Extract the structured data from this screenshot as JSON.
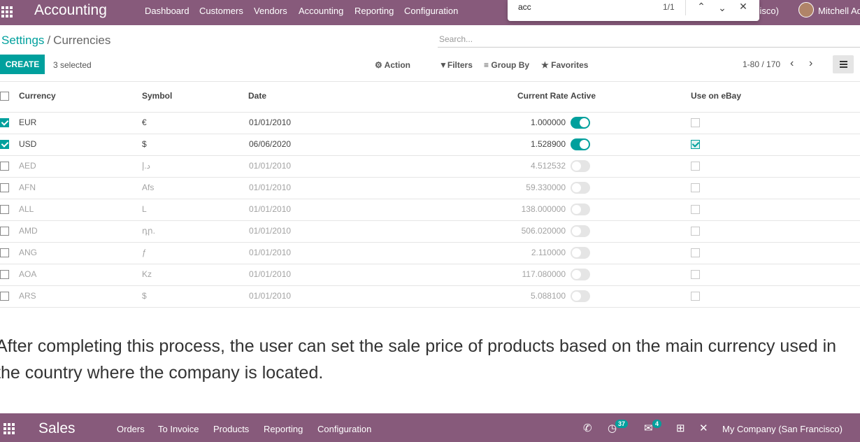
{
  "topbar": {
    "app_name": "Accounting",
    "menu": [
      "Dashboard",
      "Customers",
      "Vendors",
      "Accounting",
      "Reporting",
      "Configuration"
    ],
    "company_partial": "cisco)",
    "user": "Mitchell Ad"
  },
  "findbar": {
    "query": "acc",
    "count": "1/1"
  },
  "breadcrumb": {
    "parent": "Settings",
    "separator": "/",
    "current": "Currencies"
  },
  "search": {
    "placeholder": "Search..."
  },
  "controls": {
    "create_label": "CREATE",
    "selected_text": "3 selected",
    "action": "Action",
    "filters": "Filters",
    "group_by": "Group By",
    "favorites": "Favorites",
    "pager": "1-80 / 170"
  },
  "table": {
    "headers": {
      "currency": "Currency",
      "symbol": "Symbol",
      "date": "Date",
      "rate": "Current Rate",
      "active": "Active",
      "ebay": "Use on eBay"
    },
    "rows": [
      {
        "currency": "EUR",
        "symbol": "€",
        "date": "01/01/2010",
        "rate": "1.000000",
        "selected": true,
        "active": true,
        "ebay": false
      },
      {
        "currency": "USD",
        "symbol": "$",
        "date": "06/06/2020",
        "rate": "1.528900",
        "selected": true,
        "active": true,
        "ebay": true
      },
      {
        "currency": "AED",
        "symbol": "د.إ",
        "date": "01/01/2010",
        "rate": "4.512532",
        "selected": false,
        "active": false,
        "ebay": false
      },
      {
        "currency": "AFN",
        "symbol": "Afs",
        "date": "01/01/2010",
        "rate": "59.330000",
        "selected": false,
        "active": false,
        "ebay": false
      },
      {
        "currency": "ALL",
        "symbol": "L",
        "date": "01/01/2010",
        "rate": "138.000000",
        "selected": false,
        "active": false,
        "ebay": false
      },
      {
        "currency": "AMD",
        "symbol": "դր.",
        "date": "01/01/2010",
        "rate": "506.020000",
        "selected": false,
        "active": false,
        "ebay": false
      },
      {
        "currency": "ANG",
        "symbol": "ƒ",
        "date": "01/01/2010",
        "rate": "2.110000",
        "selected": false,
        "active": false,
        "ebay": false
      },
      {
        "currency": "AOA",
        "symbol": "Kz",
        "date": "01/01/2010",
        "rate": "117.080000",
        "selected": false,
        "active": false,
        "ebay": false
      },
      {
        "currency": "ARS",
        "symbol": "$",
        "date": "01/01/2010",
        "rate": "5.088100",
        "selected": false,
        "active": false,
        "ebay": false
      }
    ]
  },
  "paragraph": "After completing this process, the user can set the sale price of products based on the main currency used in the country where the company is located.",
  "bottombar": {
    "app_name": "Sales",
    "menu": [
      "Orders",
      "To Invoice",
      "Products",
      "Reporting",
      "Configuration"
    ],
    "activity_count": "37",
    "message_count": "4",
    "company": "My Company (San Francisco)"
  },
  "colors": {
    "brand": "#875a7b",
    "accent": "#00a09d"
  },
  "icons": [
    "apps-grid-icon",
    "gear-icon",
    "filter-icon",
    "group-by-icon",
    "star-icon",
    "chevron-left-icon",
    "chevron-right-icon",
    "list-view-icon",
    "phone-icon",
    "activity-icon",
    "chat-icon",
    "gift-icon",
    "tools-icon"
  ]
}
